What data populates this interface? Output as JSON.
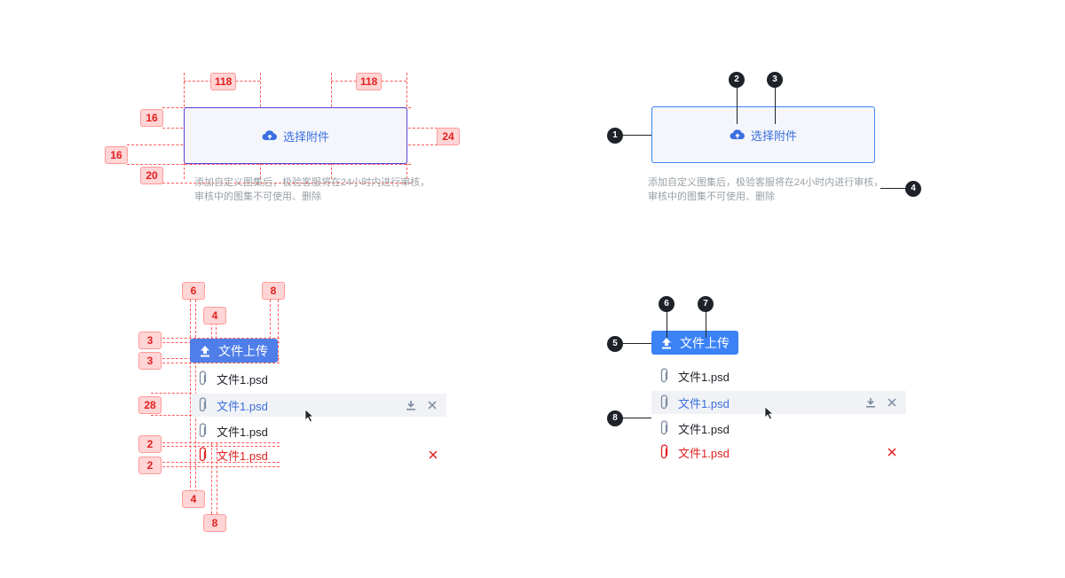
{
  "upload": {
    "label": "选择附件",
    "hint_line1": "添加自定义图集后，极验客服将在24小时内进行审核，",
    "hint_line2": "审核中的图集不可使用、删除"
  },
  "button": {
    "label": "文件上传"
  },
  "files": [
    {
      "name": "文件1.psd",
      "state": "normal"
    },
    {
      "name": "文件1.psd",
      "state": "hover"
    },
    {
      "name": "文件1.psd",
      "state": "normal"
    },
    {
      "name": "文件1.psd",
      "state": "error"
    }
  ],
  "spec_tags": {
    "top_left": "118",
    "top_right": "118",
    "pad_top": "16",
    "font_size": "24",
    "left_inset": "16",
    "pad_bottom": "20",
    "btn_icon_offset": "6",
    "btn_gap": "8",
    "btn_icon_size": "4",
    "btn_pad_top": "3",
    "btn_pad_bottom": "3",
    "row_height": "28",
    "row_gap_top": "2",
    "row_gap_bottom": "2",
    "clip_offset": "4",
    "clip_gap": "8"
  },
  "callouts": [
    "1",
    "2",
    "3",
    "4",
    "5",
    "6",
    "7",
    "8"
  ],
  "colors": {
    "primary": "#3b82f6",
    "error": "#e02020",
    "spec_red": "#ff5a5a",
    "callout": "#1f2329"
  }
}
